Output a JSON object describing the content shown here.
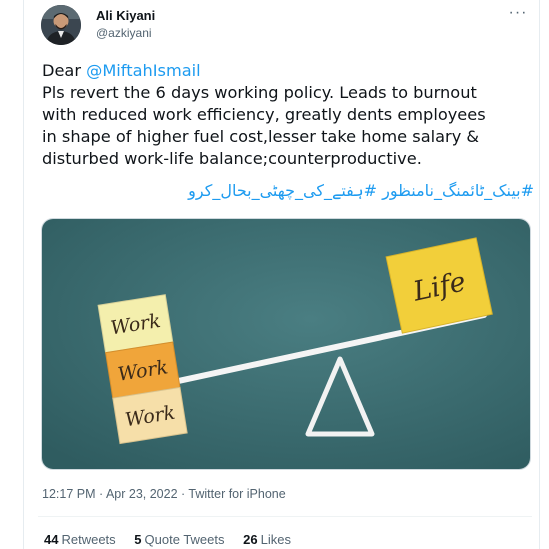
{
  "author": {
    "display_name": "Ali Kiyani",
    "handle": "@azkiyani"
  },
  "tweet": {
    "greeting": "Dear ",
    "mention": "@MiftahIsmail",
    "lines": [
      "Pls revert the 6 days working policy. Leads to burnout",
      "with reduced work efficiency, greatly dents employees",
      "in shape of higher fuel cost,lesser take home salary &",
      "disturbed work-life balance;counterproductive."
    ],
    "hashtags": "#بینک_ٹائمنگ_نامنظور #ہفتے_کی_چھٹی_بحال_کرو"
  },
  "media": {
    "image_description": "seesaw balancing work blocks and a life block",
    "blocks": [
      "Work",
      "Work",
      "Work"
    ],
    "life_label": "Life",
    "colors": {
      "background": "#3d6e72",
      "block_1": "#f4efad",
      "block_2": "#f0a53a",
      "block_3": "#f6dfa9",
      "life": "#f2cf3a",
      "beam": "#f2f2f2"
    }
  },
  "meta": {
    "time": "12:17 PM",
    "separator": " · ",
    "date": "Apr 23, 2022",
    "source": "Twitter for iPhone"
  },
  "stats": {
    "retweets_count": "44",
    "retweets_label": "Retweets",
    "quotes_count": "5",
    "quotes_label": "Quote Tweets",
    "likes_count": "26",
    "likes_label": "Likes"
  },
  "colors": {
    "link": "#1d9bf0",
    "text": "#0f1419",
    "secondary": "#536471"
  }
}
